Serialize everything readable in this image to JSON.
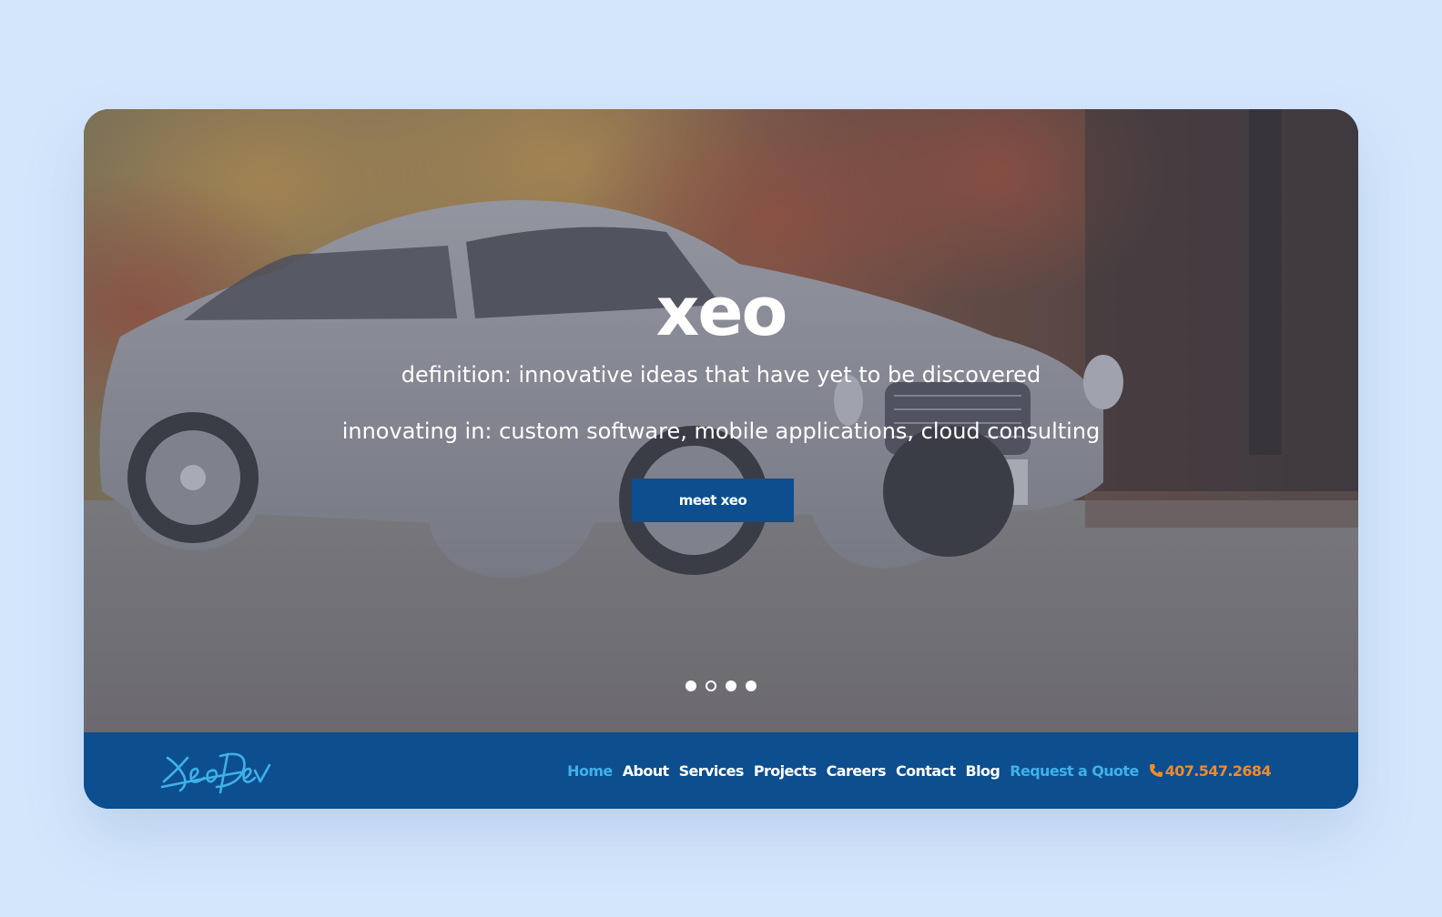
{
  "hero": {
    "title": "xeo",
    "line1": "definition: innovative ideas that have yet to be discovered",
    "line2": "innovating in: custom software, mobile applications, cloud consulting",
    "cta_label": "meet xeo",
    "slides": {
      "count": 4,
      "active_index": 1
    }
  },
  "navbar": {
    "logo_text": "XeoDev",
    "items": [
      {
        "label": "Home",
        "active": true
      },
      {
        "label": "About",
        "active": false
      },
      {
        "label": "Services",
        "active": false
      },
      {
        "label": "Projects",
        "active": false
      },
      {
        "label": "Careers",
        "active": false
      },
      {
        "label": "Contact",
        "active": false
      },
      {
        "label": "Blog",
        "active": false
      }
    ],
    "quote_label": "Request a Quote",
    "phone": "407.547.2684"
  },
  "colors": {
    "page_bg": "#d4e6fc",
    "brand_blue": "#0c4e8e",
    "accent_cyan": "#3fb1ea",
    "phone_orange": "#f08a2c"
  }
}
